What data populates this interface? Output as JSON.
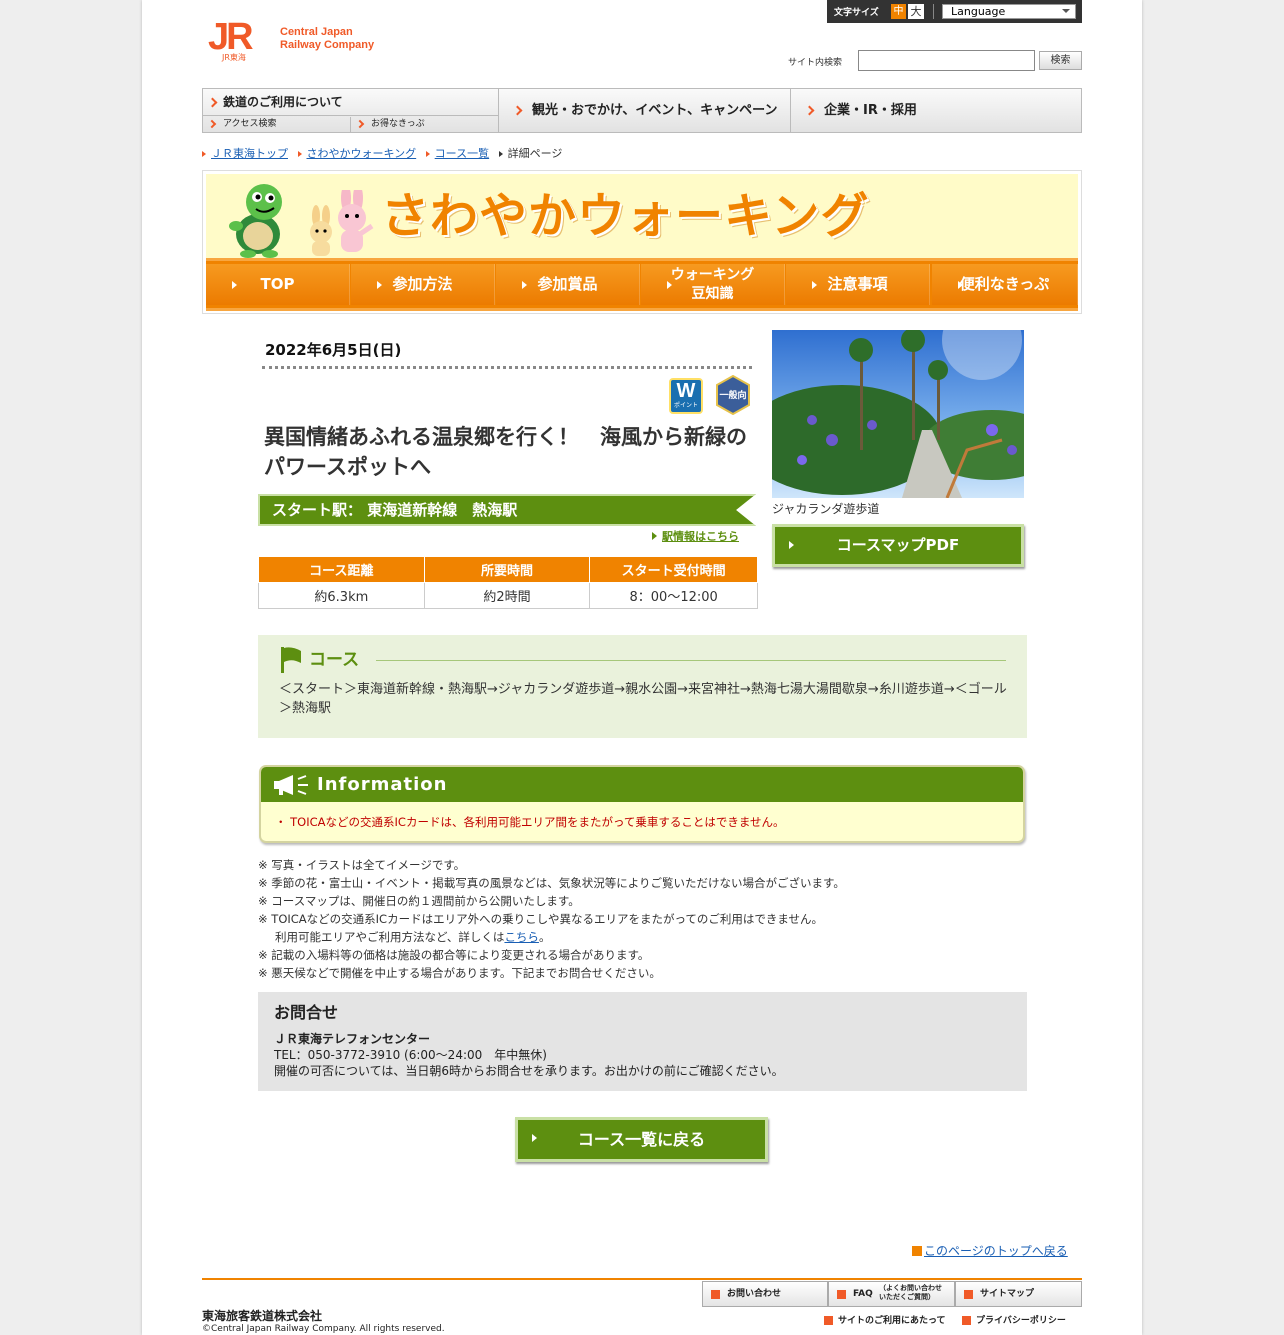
{
  "header": {
    "logo_mark": "JR",
    "logo_sub": "JR東海",
    "company_name": "Central Japan\nRailway Company",
    "font_size_label": "文字サイズ",
    "font_size_medium": "中",
    "font_size_large": "大",
    "language_label": "Language",
    "search_label": "サイト内検索",
    "search_button": "検索",
    "search_value": ""
  },
  "global_nav": {
    "rail": "鉄道のご利用について",
    "access": "アクセス検索",
    "tickets": "お得なきっぷ",
    "travel": "観光・おでかけ、イベント、キャンペーン",
    "corporate": "企業・IR・採用"
  },
  "breadcrumb": [
    "ＪＲ東海トップ",
    "さわやかウォーキング",
    "コース一覧",
    "詳細ページ"
  ],
  "banner": {
    "title": "さわやかウォーキング",
    "nav": [
      "TOP",
      "参加方法",
      "参加賞品",
      "ウォーキング\n豆知識",
      "注意事項",
      "便利なきっぷ"
    ]
  },
  "event": {
    "date": "2022年6月5日(日)",
    "badge_w": "W",
    "badge_w_sub": "ポイント",
    "badge_general": "一般向",
    "title": "異国情緒あふれる温泉郷を行く！　海風から新緑のパワースポットへ",
    "start_station": "スタート駅：  東海道新幹線　熱海駅",
    "station_info_link": "駅情報はこちら",
    "table": {
      "headers": [
        "コース距離",
        "所要時間",
        "スタート受付時間"
      ],
      "values": [
        "約6.3km",
        "約2時間",
        "8：00～12:00"
      ]
    },
    "photo_caption": "ジャカランダ遊歩道",
    "pdf_button": "コースマップPDF"
  },
  "course": {
    "heading": "コース",
    "route": "＜スタート＞東海道新幹線・熱海駅→ジャカランダ遊歩道→親水公園→来宮神社→熱海七湯大湯間歇泉→糸川遊歩道→＜ゴール＞熱海駅"
  },
  "information": {
    "heading": "Information",
    "text": "・ TOICAなどの交通系ICカードは、各利用可能エリア間をまたがって乗車することはできません。"
  },
  "notes": {
    "line1": "※ 写真・イラストは全てイメージです。",
    "line2": "※ 季節の花・富士山・イベント・掲載写真の風景などは、気象状況等によりご覧いただけない場合がございます。",
    "line3": "※ コースマップは、開催日の約１週間前から公開いたします。",
    "line4": "※ TOICAなどの交通系ICカードはエリア外への乗りこしや異なるエリアをまたがってのご利用はできません。",
    "line5_pre": "利用可能エリアやご利用方法など、詳しくは",
    "line5_link": "こちら",
    "line5_post": "。",
    "line6": "※ 記載の入場料等の価格は施設の都合等により変更される場合があります。",
    "line7": "※ 悪天候などで開催を中止する場合があります。下記までお問合せください。"
  },
  "contact": {
    "heading": "お問合せ",
    "name": "ＪＲ東海テレフォンセンター",
    "tel": "TEL：050-3772-3910 (6:00～24:00　年中無休)",
    "note": "開催の可否については、当日朝6時からお問合せを承ります。お出かけの前にご確認ください。"
  },
  "back_button": "コース一覧に戻る",
  "page_top_link": "このページのトップへ戻る",
  "footer": {
    "inquiry": "お問い合わせ",
    "faq_main": "FAQ",
    "faq_sub": "（よくお問い合わせ\nいただくご質問）",
    "sitemap": "サイトマップ",
    "site_usage": "サイトのご利用にあたって",
    "privacy": "プライバシーポリシー",
    "corp_name": "東海旅客鉄道株式会社",
    "copyright": "©Central Japan Railway Company. All rights reserved."
  },
  "colors": {
    "brand_orange": "#f08300",
    "jr_orange": "#f05a28",
    "green": "#5d8f10",
    "course_bg": "#eaf2dc",
    "info_bg": "#ffffd0",
    "alert_red": "#c00000"
  }
}
